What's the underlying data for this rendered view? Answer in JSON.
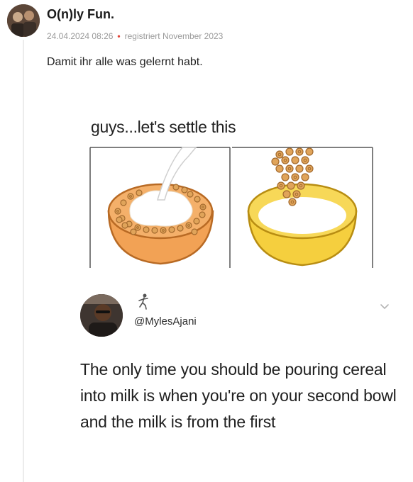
{
  "post": {
    "username": "O(n)ly Fun.",
    "date": "24.04.2024 08:26",
    "separator": "•",
    "registered": "registriert November 2023",
    "text": "Damit ihr alle was gelernt habt."
  },
  "meme": {
    "title": "guys...let's settle this",
    "tweet": {
      "handle": "@MylesAjani",
      "text": "The only time you should be pouring cereal into milk is when you're on your second bowl and the milk is from the first"
    }
  },
  "colors": {
    "bowl_left": "#f2a255",
    "bowl_right": "#f5cf3e",
    "cereal": "#e0a45a",
    "meta_dot": "#e2463a"
  },
  "icons": {
    "chevron": "chevron-down-icon",
    "emoji": "figure-emoji-icon"
  }
}
